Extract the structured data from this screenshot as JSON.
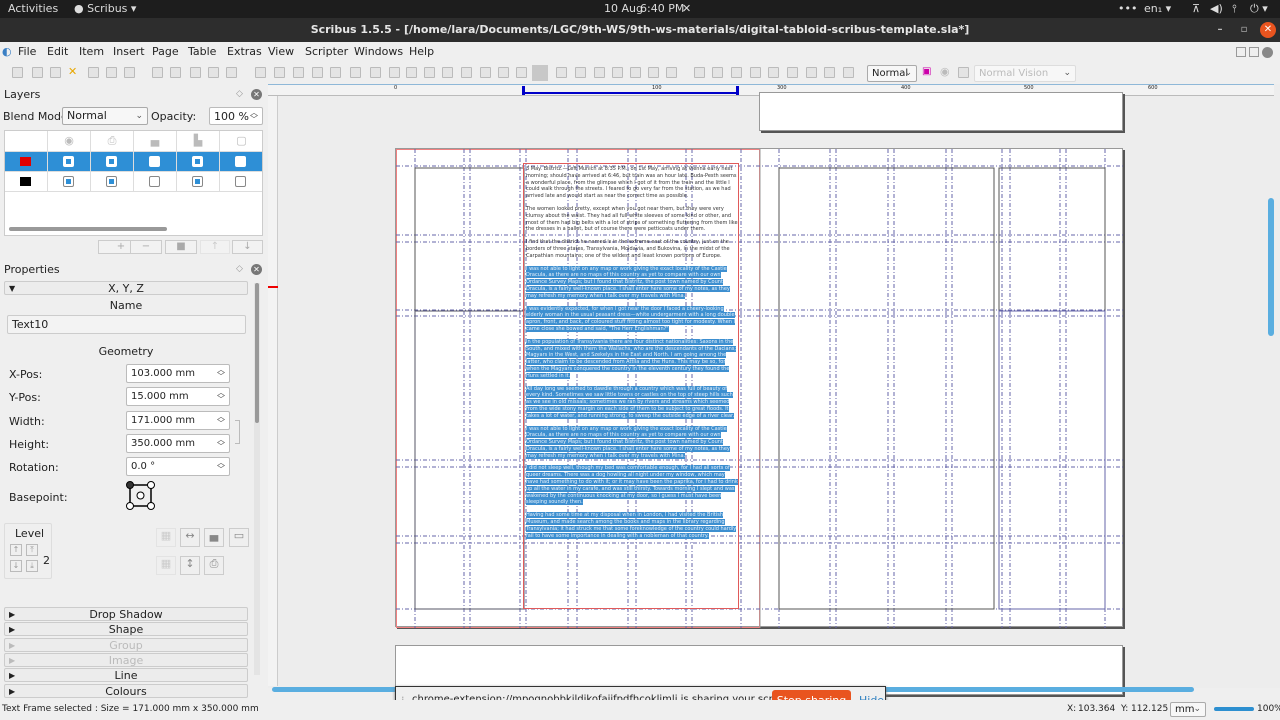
{
  "system_bar": {
    "activities": "Activities",
    "app_menu": "Scribus",
    "date": "10 Aug",
    "time": "6:40 PM",
    "lang": "en₁",
    "overflow": "•••"
  },
  "window": {
    "title": "Scribus 1.5.5 - [/home/lara/Documents/LGC/9th-WS/9th-ws-materials/digital-tabloid-scribus-template.sla*]"
  },
  "menu": [
    "File",
    "Edit",
    "Item",
    "Insert",
    "Page",
    "Table",
    "Extras",
    "View",
    "Scripter",
    "Windows",
    "Help"
  ],
  "toolbar": {
    "preview_mode": "Normal",
    "vision_mode": "Normal Vision"
  },
  "layers": {
    "title": "Layers",
    "blend_label": "Blend Mode:",
    "blend_value": "Normal",
    "opacity_label": "Opacity:",
    "opacity_value": "100 %",
    "columns": [
      "color",
      "visible",
      "printable",
      "locked",
      "flow",
      "outline"
    ],
    "rows": [
      {
        "color": "#e00000",
        "visible": true,
        "printable": true,
        "locked": false,
        "flow": true,
        "outline": false,
        "selected": true
      },
      {
        "color": "#000000",
        "visible": true,
        "printable": true,
        "locked": false,
        "flow": true,
        "outline": false,
        "selected": false
      }
    ],
    "buttons": [
      "+",
      "−",
      "■",
      "↑",
      "↓"
    ]
  },
  "properties": {
    "title": "Properties",
    "xyz_section": "X, Y, Z",
    "name_label": "Name",
    "name_value": "Text10",
    "geometry_label": "Geometry",
    "xpos_label": "X-Pos:",
    "xpos_value": "103.000 mm",
    "ypos_label": "Y-Pos:",
    "ypos_value": "15.000 mm",
    "width_label": "Width:",
    "width_value": "171.000 mm",
    "height_label": "Height:",
    "height_value": "350.000 mm",
    "rotation_label": "Rotation:",
    "rotation_value": "0.0 °",
    "basepoint_label": "Basepoint:",
    "level_label": "Level",
    "level_value": "2",
    "sections": [
      {
        "label": "Drop Shadow",
        "enabled": true
      },
      {
        "label": "Shape",
        "enabled": true
      },
      {
        "label": "Group",
        "enabled": false
      },
      {
        "label": "Image",
        "enabled": false
      },
      {
        "label": "Line",
        "enabled": true
      },
      {
        "label": "Colours",
        "enabled": true
      }
    ]
  },
  "ruler": {
    "labels": [
      "0",
      "100",
      "300",
      "400",
      "500",
      "600"
    ]
  },
  "text_frame": {
    "plain": [
      "3 May. Bistritz.—Left Munich at 8:35 P.M., on 1st May, arriving at Vienna early next morning; should have arrived at 6:46, but train was an hour late. Buda-Pesth seems a wonderful place, from the glimpse which I got of it from the train and the little I could walk through the streets. I feared to go very far from the station, as we had arrived late and would start as near the correct time as possible.",
      "The women looked pretty, except when you got near them, but they were very clumsy about the waist. They had all full white sleeves of some kind or other, and most of them had big belts with a lot of strips of something fluttering from them like the dresses in a ballet, but of course there were petticoats under them.",
      "I find that the district he named is in the extreme east of the country, just on the borders of three states, Transylvania, Moldavia, and Bukovina, in the midst of the Carpathian mountains; one of the wildest and least known portions of Europe."
    ],
    "selected": [
      "I was not able to light on any map or work giving the exact locality of the Castle Dracula, as there are no maps of this country as yet to compare with our own Ordance Survey Maps; but I found that Bistritz, the post town named by Count Dracula, is a fairly well-known place. I shall enter here some of my notes, as they may refresh my memory when I talk over my travels with Mina.",
      "I was evidently expected, for when I got near the door I faced a cheery-looking elderly woman in the usual peasant dress—white undergarment with a long double apron, front, and back, of coloured stuff fitting almost too tight for modesty. When I came close she bowed and said, \"The Herr Englishman?\"",
      "In the population of Transylvania there are four distinct nationalities: Saxons in the South, and mixed with them the Wallachs, who are the descendants of the Dacians; Magyars in the West, and Szekelys in the East and North. I am going among the latter, who claim to be descended from Attila and the Huns. This may be so, for when the Magyars conquered the country in the eleventh century they found the Huns settled in it.",
      "All day long we seemed to dawdle through a country which was full of beauty of every kind. Sometimes we saw little towns or castles on the top of steep hills such as we see in old missals; sometimes we ran by rivers and streams which seemed from the wide stony margin on each side of them to be subject to great floods. It takes a lot of water, and running strong, to sweep the outside edge of a river clear.",
      "I was not able to light on any map or work giving the exact locality of the Castle Dracula, as there are no maps of this country as yet to compare with our own Ordance Survey Maps; but I found that Bistritz, the post town named by Count Dracula, is a fairly well-known place. I shall enter here some of my notes, as they may refresh my memory when I talk over my travels with Mina.",
      "I did not sleep well, though my bed was comfortable enough, for I had all sorts of queer dreams. There was a dog howling all night under my window, which may have had something to do with it; or it may have been the paprika, for I had to drink up all the water in my carafe, and was still thirsty. Towards morning I slept and was wakened by the continuous knocking at my door, so I guess I must have been sleeping soundly then.",
      "Having had some time at my disposal when in London, I had visited the British Museum, and made search among the books and maps in the library regarding Transylvania; it had struck me that some foreknowledge of the country could hardly fail to have some importance in dealing with a nobleman of that country."
    ]
  },
  "share_bar": {
    "message": "chrome-extension://mpognobbkildjkofajifpdfhcoklimli is sharing your screen.",
    "stop_label": "Stop sharing",
    "hide_label": "Hide"
  },
  "status": {
    "message": "Text Frame selected : Size = 171.000 mm x 350.000 mm",
    "x_label": "X:",
    "x_value": "103.364",
    "y_label": "Y:",
    "y_value": "112.125",
    "unit": "mm",
    "zoom": "100%"
  }
}
